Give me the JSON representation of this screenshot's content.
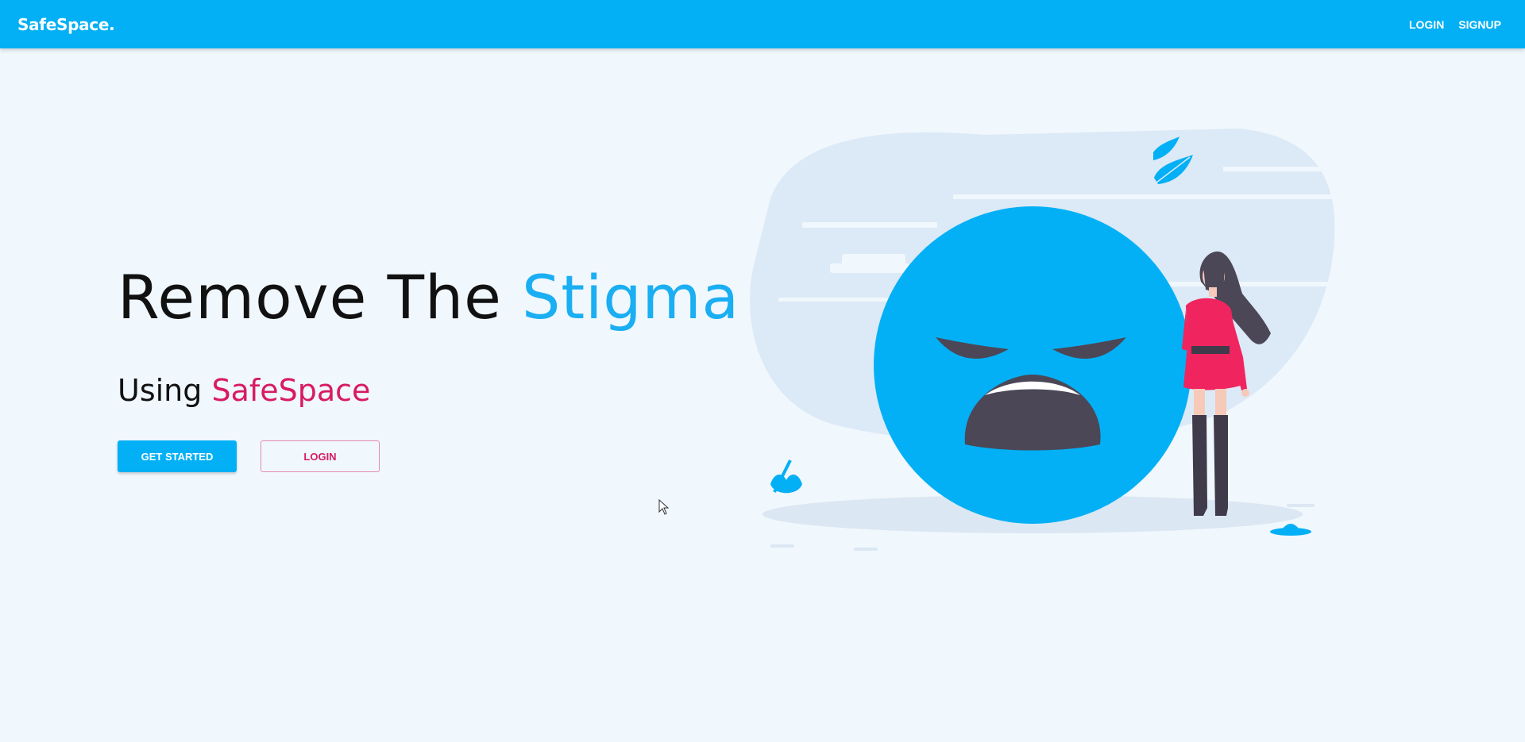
{
  "navbar": {
    "brand": "SafeSpace.",
    "links": [
      {
        "label": "LOGIN"
      },
      {
        "label": "SIGNUP"
      }
    ],
    "background": "#03b0f5"
  },
  "hero": {
    "title_main": "Remove The ",
    "title_accent": "Stigma",
    "subtitle_prefix": "Using ",
    "subtitle_brand": "SafeSpace",
    "primary_button": "GET STARTED",
    "secondary_button": "LOGIN"
  },
  "colors": {
    "accent_blue": "#1aaef2",
    "accent_pink": "#d81b60",
    "page_background": "#f0f7fd"
  },
  "illustration": {
    "subject": "sad-emoji-with-woman",
    "icons": [
      "sad-face-icon",
      "leaf-icon",
      "woman-figure"
    ]
  }
}
